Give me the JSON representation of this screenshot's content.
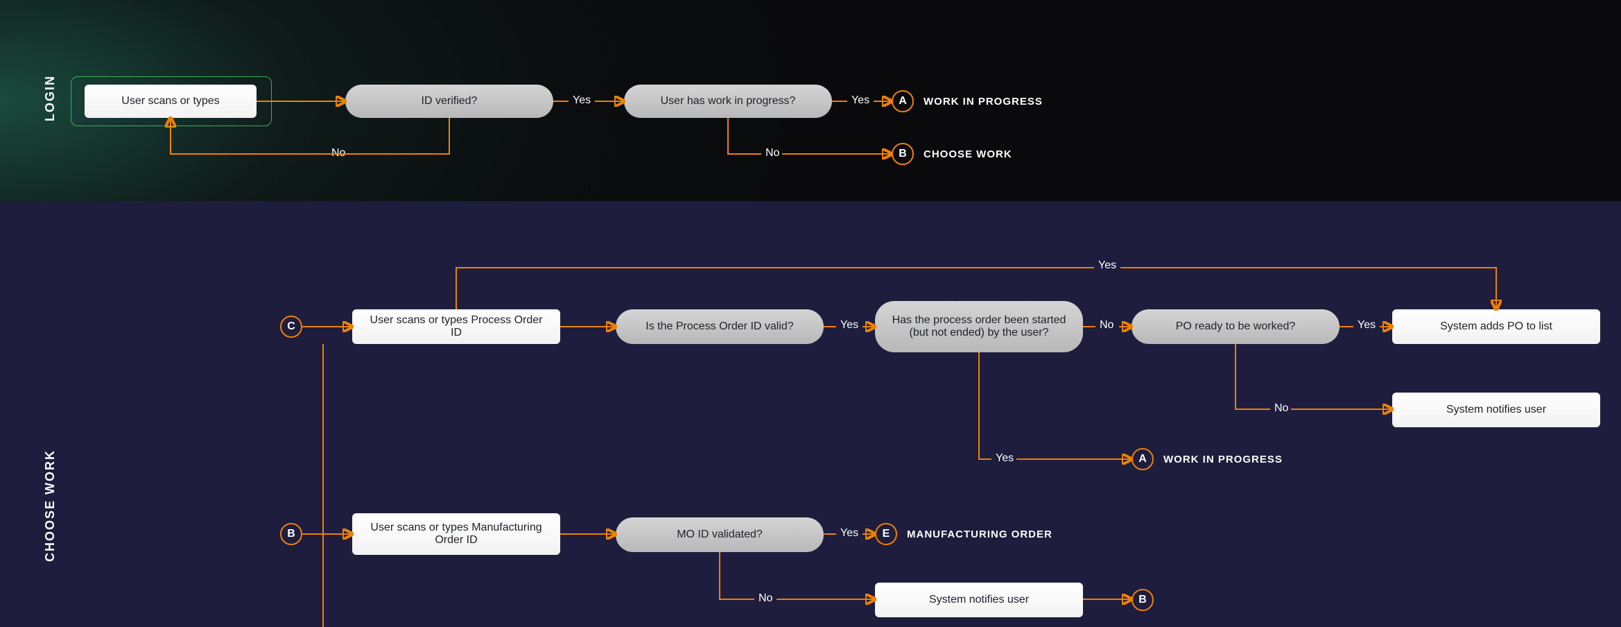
{
  "sections": {
    "login": {
      "label": "LOGIN"
    },
    "choose": {
      "label": "CHOOSE WORK"
    }
  },
  "colors": {
    "accent": "#ed8106",
    "green": "#3fae5a"
  },
  "nodes": {
    "scan_id": "User scans or types",
    "id_verified": "ID verified?",
    "wip_q": "User has work in progress?",
    "scan_po": "User scans or types Process Order ID",
    "po_valid": "Is the Process Order ID valid?",
    "po_started": "Has the process order been started (but not ended) by the user?",
    "po_ready": "PO ready to be worked?",
    "add_po": "System adds PO to list",
    "notify1": "System notifies user",
    "scan_mo": "User scans or types Manufacturing  Order ID",
    "mo_valid": "MO ID validated?",
    "notify2": "System notifies user"
  },
  "badges": {
    "A": "A",
    "B": "B",
    "C": "C",
    "E": "E"
  },
  "outcomes": {
    "work_in_progress": "WORK IN PROGRESS",
    "choose_work": "CHOOSE WORK",
    "manufacturing_order": "MANUFACTURING ORDER"
  },
  "edge_labels": {
    "yes": "Yes",
    "no": "No"
  }
}
